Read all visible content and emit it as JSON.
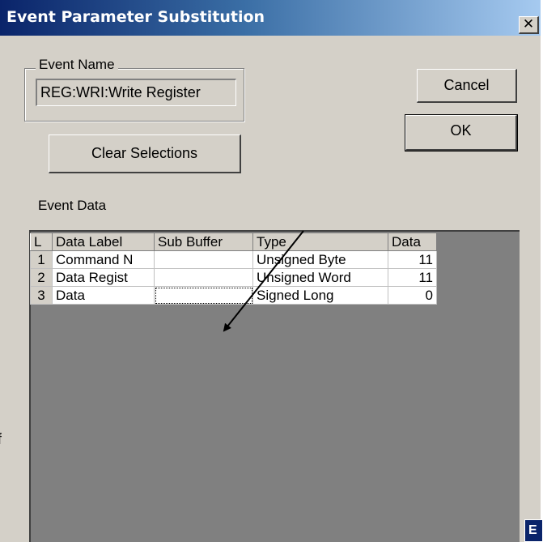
{
  "dialog": {
    "title": "Event Parameter Substitution",
    "close_glyph": "✕",
    "event_name": {
      "legend": "Event Name",
      "value": "REG:WRI:Write Register"
    },
    "buttons": {
      "cancel": "Cancel",
      "ok": "OK",
      "clear_selections": "Clear Selections"
    },
    "event_data_label": "Event Data",
    "table": {
      "headers": [
        "L",
        "Data Label",
        "Sub Buffer",
        "Type",
        "Data"
      ],
      "rows": [
        {
          "num": "1",
          "label": "Command N",
          "sub_buffer": "",
          "type": "Unsigned Byte",
          "data": "11"
        },
        {
          "num": "2",
          "label": "Data Regist",
          "sub_buffer": "",
          "type": "Unsigned Word",
          "data": "11"
        },
        {
          "num": "3",
          "label": "Data",
          "sub_buffer": "",
          "type": "Signed Long",
          "data": "0"
        }
      ]
    }
  },
  "background": {
    "stray_text": "f",
    "window_letter": "E"
  },
  "colors": {
    "title_gradient_start": "#0a246a",
    "title_gradient_end": "#a6caf0",
    "dialog_face": "#d4d0c8",
    "grid_background": "#808080",
    "arrow": "#000000"
  },
  "icons": {
    "close": "close-icon",
    "annotation": "arrow-annotation"
  }
}
